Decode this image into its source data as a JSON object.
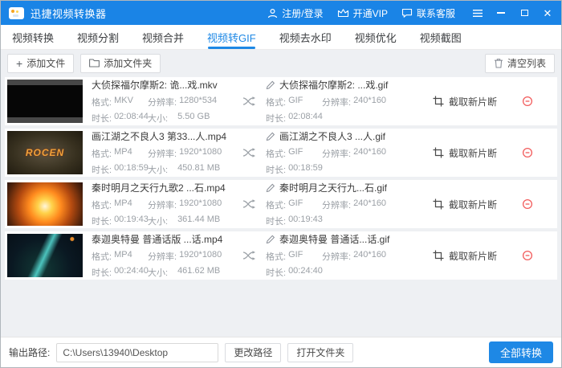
{
  "colors": {
    "titlebar": "#1a84e6",
    "accent": "#1e88e5",
    "danger": "#f25c5c",
    "list_bg": "#eef0f3"
  },
  "titlebar": {
    "app_title": "迅捷视频转换器",
    "register_login": "注册/登录",
    "vip": "开通VIP",
    "support": "联系客服"
  },
  "tabs": [
    {
      "label": "视频转换",
      "active": false
    },
    {
      "label": "视频分割",
      "active": false
    },
    {
      "label": "视频合并",
      "active": false
    },
    {
      "label": "视频转GIF",
      "active": true
    },
    {
      "label": "视频去水印",
      "active": false
    },
    {
      "label": "视频优化",
      "active": false
    },
    {
      "label": "视频截图",
      "active": false
    }
  ],
  "toolbar": {
    "add_file": "添加文件",
    "add_folder": "添加文件夹",
    "clear_list": "清空列表"
  },
  "list": {
    "crop_label": "截取新片断",
    "labels": {
      "format": "格式:",
      "resolution": "分辨率:",
      "duration": "时长:",
      "size": "大小:"
    },
    "rows": [
      {
        "thumb": "thumb-holmes",
        "thumb_text": "",
        "source": {
          "name": "大侦探福尔摩斯2: 诡...戏.mkv",
          "format": "MKV",
          "resolution": "1280*534",
          "duration": "02:08:44",
          "size": "5.50 GB"
        },
        "target": {
          "name": "大侦探福尔摩斯2: ...戏.gif",
          "format": "GIF",
          "resolution": "240*160",
          "duration": "02:08:44"
        }
      },
      {
        "thumb": "thumb-rocen",
        "thumb_text": "ROCEN",
        "source": {
          "name": "画江湖之不良人3 第33...人.mp4",
          "format": "MP4",
          "resolution": "1920*1080",
          "duration": "00:18:59",
          "size": "450.81 MB"
        },
        "target": {
          "name": "画江湖之不良人3 ...人.gif",
          "format": "GIF",
          "resolution": "240*160",
          "duration": "00:18:59"
        }
      },
      {
        "thumb": "thumb-qin",
        "thumb_text": "",
        "source": {
          "name": "秦时明月之天行九歌2 ...石.mp4",
          "format": "MP4",
          "resolution": "1920*1080",
          "duration": "00:19:43",
          "size": "361.44 MB"
        },
        "target": {
          "name": "秦时明月之天行九...石.gif",
          "format": "GIF",
          "resolution": "240*160",
          "duration": "00:19:43"
        }
      },
      {
        "thumb": "thumb-taiga",
        "thumb_text": "",
        "source": {
          "name": "泰迦奥特曼 普通话版 ...话.mp4",
          "format": "MP4",
          "resolution": "1920*1080",
          "duration": "00:24:40",
          "size": "461.62 MB"
        },
        "target": {
          "name": "泰迦奥特曼 普通话...话.gif",
          "format": "GIF",
          "resolution": "240*160",
          "duration": "00:24:40"
        }
      }
    ]
  },
  "footer": {
    "output_path_label": "输出路径:",
    "output_path_value": "C:\\Users\\13940\\Desktop",
    "change_path": "更改路径",
    "open_folder": "打开文件夹",
    "convert_all": "全部转换"
  }
}
